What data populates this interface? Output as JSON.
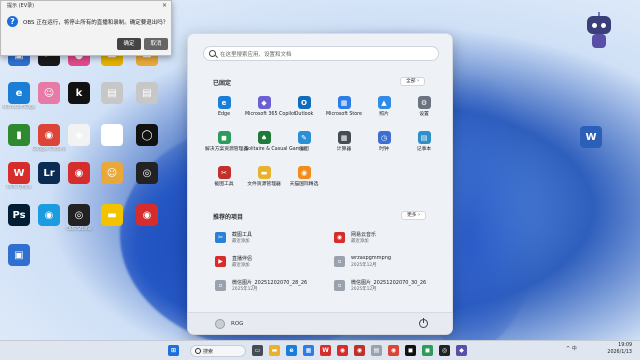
{
  "dialog": {
    "title": "提示 (EV录)",
    "message": "OBS 正在运行，将停止所有的直播和录制。确定要退出吗？",
    "ok": "确定",
    "cancel": "取消",
    "close": "×"
  },
  "desktop_icons": [
    {
      "label": "",
      "color": "#2f6fd1",
      "glyph": "▣"
    },
    {
      "label": "",
      "color": "#1a1a1a",
      "glyph": "✂"
    },
    {
      "label": "",
      "color": "#e04a8c",
      "glyph": "●"
    },
    {
      "label": "",
      "color": "#e3b100",
      "glyph": "▬"
    },
    {
      "label": "",
      "color": "#e8a93a",
      "glyph": "▬"
    },
    {
      "label": "Microsoft Edge",
      "color": "#1b7ed6",
      "glyph": "e"
    },
    {
      "label": "",
      "color": "#e87aa7",
      "glyph": "☺"
    },
    {
      "label": "",
      "color": "#111111",
      "glyph": "k"
    },
    {
      "label": "",
      "color": "#c7c7c7",
      "glyph": "▤"
    },
    {
      "label": "",
      "color": "#c7c7c7",
      "glyph": "▤"
    },
    {
      "label": "",
      "color": "#2f8a2f",
      "glyph": "▮"
    },
    {
      "label": "Google Chrome",
      "color": "#db4437",
      "glyph": "◉"
    },
    {
      "label": "",
      "color": "#f2f2f2",
      "glyph": "◈"
    },
    {
      "label": "",
      "color": "#ffffff",
      "glyph": "♥"
    },
    {
      "label": "",
      "color": "#111111",
      "glyph": "◯"
    },
    {
      "label": "WPS Office",
      "color": "#d62c2c",
      "glyph": "W"
    },
    {
      "label": "",
      "color": "#0b2b53",
      "glyph": "Lr"
    },
    {
      "label": "",
      "color": "#d62c2c",
      "glyph": "◉"
    },
    {
      "label": "",
      "color": "#e8a93a",
      "glyph": "☺"
    },
    {
      "label": "",
      "color": "#222222",
      "glyph": "◎"
    },
    {
      "label": "",
      "color": "#001d34",
      "glyph": "Ps"
    },
    {
      "label": "",
      "color": "#1b9be0",
      "glyph": "◉"
    },
    {
      "label": "OBS Studio",
      "color": "#222222",
      "glyph": "◎"
    },
    {
      "label": "",
      "color": "#f2c400",
      "glyph": "▬"
    },
    {
      "label": "",
      "color": "#d62c2c",
      "glyph": "◉"
    },
    {
      "label": "",
      "color": "#2f6fd1",
      "glyph": "▣"
    }
  ],
  "right_desktop_icon": {
    "label": "",
    "color": "#2b5fb8",
    "glyph": "W"
  },
  "start_menu": {
    "search_placeholder": "在这里搜索应用、设置和文档",
    "pinned_title": "已固定",
    "all_button": "全部 ›",
    "pinned": [
      {
        "label": "Edge",
        "color": "#1b7ed6",
        "glyph": "e"
      },
      {
        "label": "Microsoft 365 Copilot",
        "color": "#6c5fd6",
        "glyph": "◆"
      },
      {
        "label": "Outlook",
        "color": "#0f6cbd",
        "glyph": "O"
      },
      {
        "label": "Microsoft Store",
        "color": "#2b7de9",
        "glyph": "▦"
      },
      {
        "label": "照片",
        "color": "#2f8be6",
        "glyph": "▲"
      },
      {
        "label": "设置",
        "color": "#6b7380",
        "glyph": "⚙"
      },
      {
        "label": "解决方案资源管理器",
        "color": "#2d9c5a",
        "glyph": "◼"
      },
      {
        "label": "Solitaire & Casual Games",
        "color": "#1f7a3a",
        "glyph": "♠"
      },
      {
        "label": "画图",
        "color": "#2a8fd6",
        "glyph": "✎"
      },
      {
        "label": "计算器",
        "color": "#444c56",
        "glyph": "▦"
      },
      {
        "label": "时钟",
        "color": "#3b6fd6",
        "glyph": "◷"
      },
      {
        "label": "记事本",
        "color": "#2f8fc9",
        "glyph": "▤"
      },
      {
        "label": "截图工具",
        "color": "#c2302b",
        "glyph": "✂"
      },
      {
        "label": "文件资源管理器",
        "color": "#e8b12e",
        "glyph": "▬"
      },
      {
        "label": "天猫国际精选",
        "color": "#f28c1a",
        "glyph": "◉"
      }
    ],
    "recommended_title": "推荐的项目",
    "more_button": "更多 ›",
    "recommended": [
      {
        "name": "截图工具",
        "sub": "最近添加",
        "color": "#2a7fd6",
        "glyph": "✂"
      },
      {
        "name": "网易云音乐",
        "sub": "最近添加",
        "color": "#d62c2c",
        "glyph": "◉"
      },
      {
        "name": "直播伴侣",
        "sub": "最近添加",
        "color": "#d62c2c",
        "glyph": "▶"
      },
      {
        "name": "wrzaspgmmpng",
        "sub": "2025年12月",
        "color": "#9aa3ad",
        "glyph": "▫"
      },
      {
        "name": "微信图片_20251202070_28_26",
        "sub": "2025年12月",
        "color": "#9aa3ad",
        "glyph": "▫"
      },
      {
        "name": "微信图片_20251202070_30_26",
        "sub": "2025年12月",
        "color": "#9aa3ad",
        "glyph": "▫"
      }
    ],
    "user": "ROG"
  },
  "taskbar": {
    "search_label": "搜索",
    "apps": [
      {
        "name": "start",
        "color": "#1e6fd9",
        "glyph": "⊞"
      },
      {
        "name": "task-view",
        "color": "#444c56",
        "glyph": "▭"
      },
      {
        "name": "file-explorer",
        "color": "#e8b12e",
        "glyph": "▬"
      },
      {
        "name": "edge",
        "color": "#1b7ed6",
        "glyph": "e"
      },
      {
        "name": "store",
        "color": "#2b7de9",
        "glyph": "▦"
      },
      {
        "name": "wps",
        "color": "#d62c2c",
        "glyph": "W"
      },
      {
        "name": "app-red",
        "color": "#d62c2c",
        "glyph": "◉"
      },
      {
        "name": "app-netease",
        "color": "#c2302b",
        "glyph": "◉"
      },
      {
        "name": "app-doc",
        "color": "#9aa3ad",
        "glyph": "▤"
      },
      {
        "name": "chrome",
        "color": "#db4437",
        "glyph": "◉"
      },
      {
        "name": "app-dark",
        "color": "#111111",
        "glyph": "◼"
      },
      {
        "name": "app-green",
        "color": "#2d9c5a",
        "glyph": "◼"
      },
      {
        "name": "obs",
        "color": "#222222",
        "glyph": "◎"
      },
      {
        "name": "app-purple",
        "color": "#5a4fa8",
        "glyph": "◆"
      }
    ],
    "tray_text": "^ 中",
    "time": "19:09",
    "date": "2026/1/13"
  }
}
